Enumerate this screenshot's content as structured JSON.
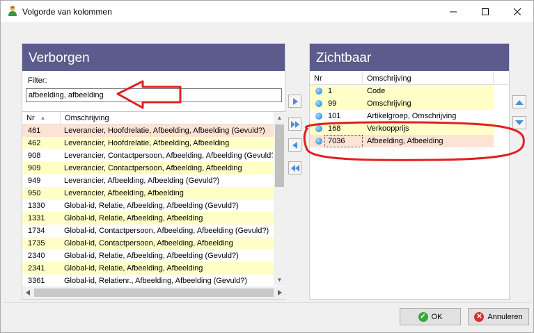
{
  "window": {
    "title": "Volgorde van kolommen"
  },
  "left_panel": {
    "header": "Verborgen",
    "filter_label": "Filter:",
    "filter_value": "afbeelding, afbeelding",
    "columns": [
      "Nr",
      "Omschrijving"
    ],
    "rows": [
      {
        "nr": "461",
        "desc": "Leverancier, Hoofdrelatie, Afbeelding, Afbeelding (Gevuld?)"
      },
      {
        "nr": "462",
        "desc": "Leverancier, Hoofdrelatie, Afbeelding, Afbeelding"
      },
      {
        "nr": "908",
        "desc": "Leverancier, Contactpersoon, Afbeelding, Afbeelding (Gevuld?)"
      },
      {
        "nr": "909",
        "desc": "Leverancier, Contactpersoon, Afbeelding, Afbeelding"
      },
      {
        "nr": "949",
        "desc": "Leverancier, Afbeelding, Afbeelding (Gevuld?)"
      },
      {
        "nr": "950",
        "desc": "Leverancier, Afbeelding, Afbeelding"
      },
      {
        "nr": "1330",
        "desc": "Global-id, Relatie, Afbeelding, Afbeelding (Gevuld?)"
      },
      {
        "nr": "1331",
        "desc": "Global-id, Relatie, Afbeelding, Afbeelding"
      },
      {
        "nr": "1734",
        "desc": "Global-id, Contactpersoon, Afbeelding, Afbeelding (Gevuld?)"
      },
      {
        "nr": "1735",
        "desc": "Global-id, Contactpersoon, Afbeelding, Afbeelding"
      },
      {
        "nr": "2340",
        "desc": "Global-id, Relatie, Afbeelding, Afbeelding (Gevuld?)"
      },
      {
        "nr": "2341",
        "desc": "Global-id, Relatie, Afbeelding, Afbeelding"
      },
      {
        "nr": "3361",
        "desc": "Global-id, Relatienr., Afbeelding, Afbeelding (Gevuld?)"
      }
    ]
  },
  "right_panel": {
    "header": "Zichtbaar",
    "columns": [
      "Nr",
      "Omschrijving"
    ],
    "rows": [
      {
        "nr": "1",
        "desc": "Code"
      },
      {
        "nr": "99",
        "desc": "Omschrijving"
      },
      {
        "nr": "101",
        "desc": "Artikelgroep, Omschrijving"
      },
      {
        "nr": "168",
        "desc": "Verkoopprijs"
      },
      {
        "nr": "7036",
        "desc": "Afbeelding, Afbeelding"
      }
    ]
  },
  "buttons": {
    "ok": "OK",
    "cancel": "Annuleren"
  },
  "colors": {
    "header": "#5b5b8c",
    "row_odd": "#ffffc8",
    "row_hilite": "#fde3d4",
    "annotation": "#e02020"
  }
}
